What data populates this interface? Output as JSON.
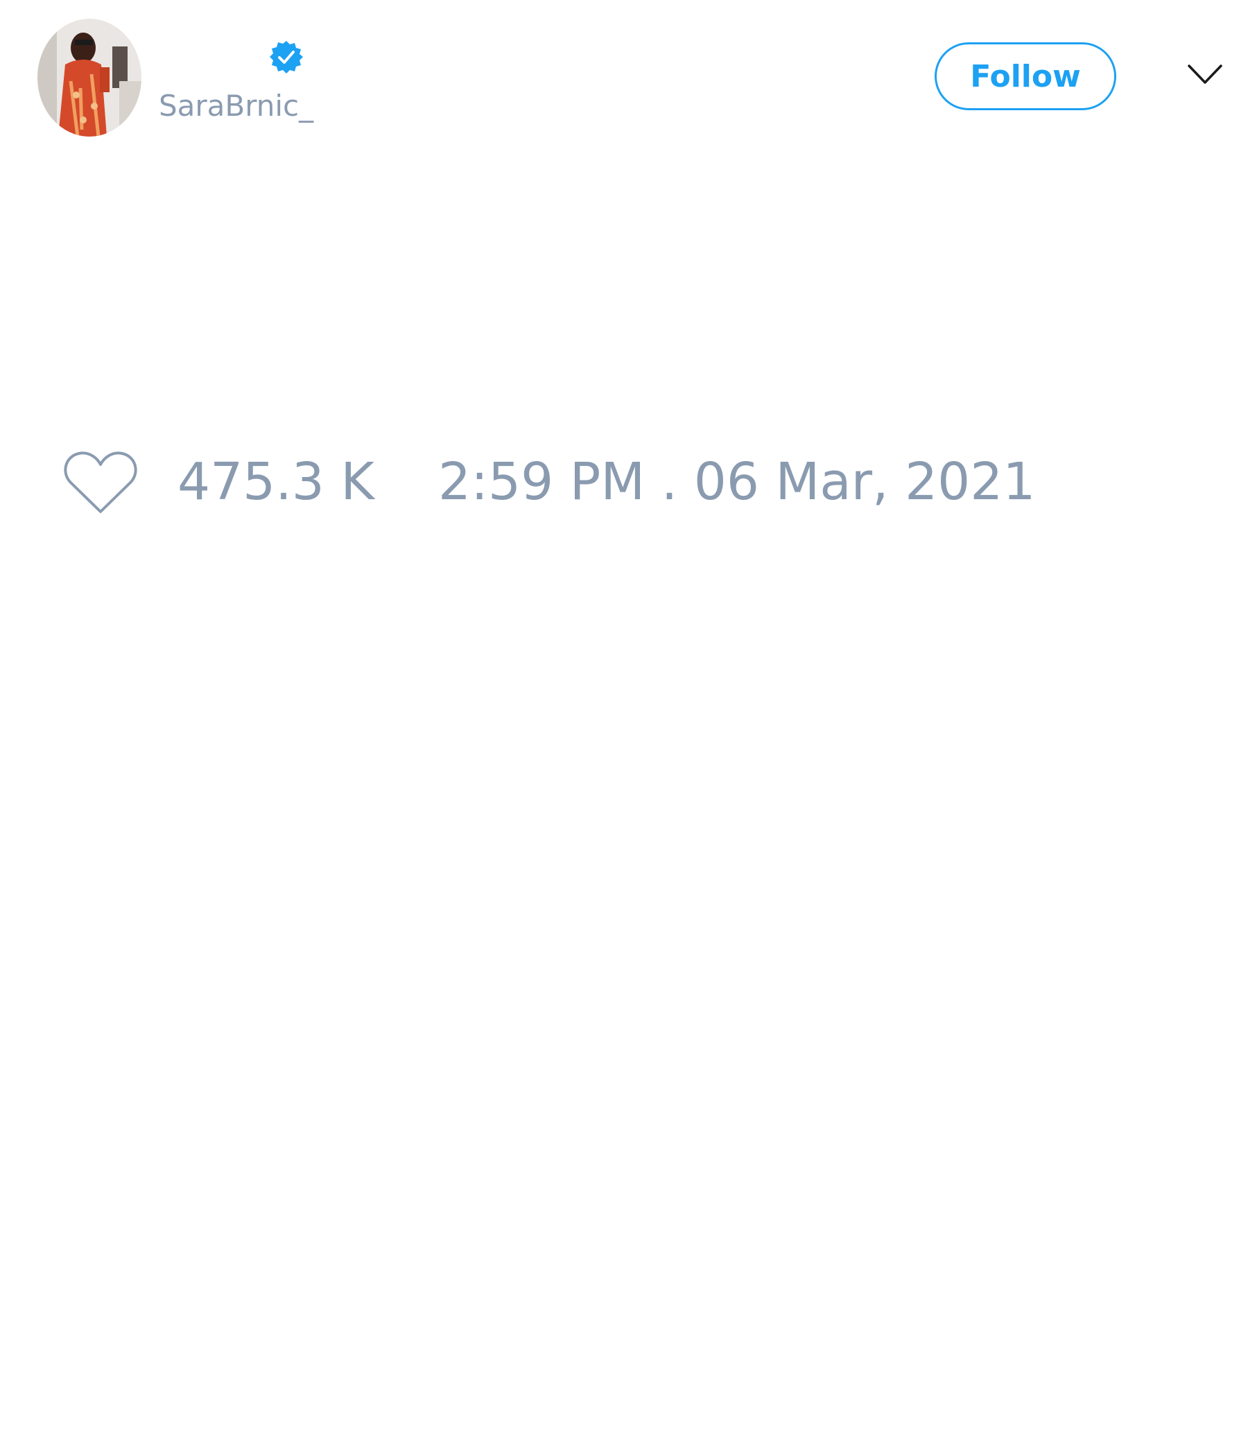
{
  "tweet": {
    "author": {
      "handle": "SaraBrnic_",
      "verified": true,
      "avatar": "avatar-photo"
    },
    "actions": {
      "follow_label": "Follow",
      "more_icon": "chevron-down-icon"
    },
    "likes": "475.3 K",
    "timestamp": "2:59 PM . 06 Mar, 2021",
    "icons": {
      "like": "heart-outline-icon",
      "verified": "verified-badge-icon"
    }
  },
  "colors": {
    "accent": "#1da1f2",
    "muted_text": "#8a9bb0",
    "background": "#ffffff"
  }
}
